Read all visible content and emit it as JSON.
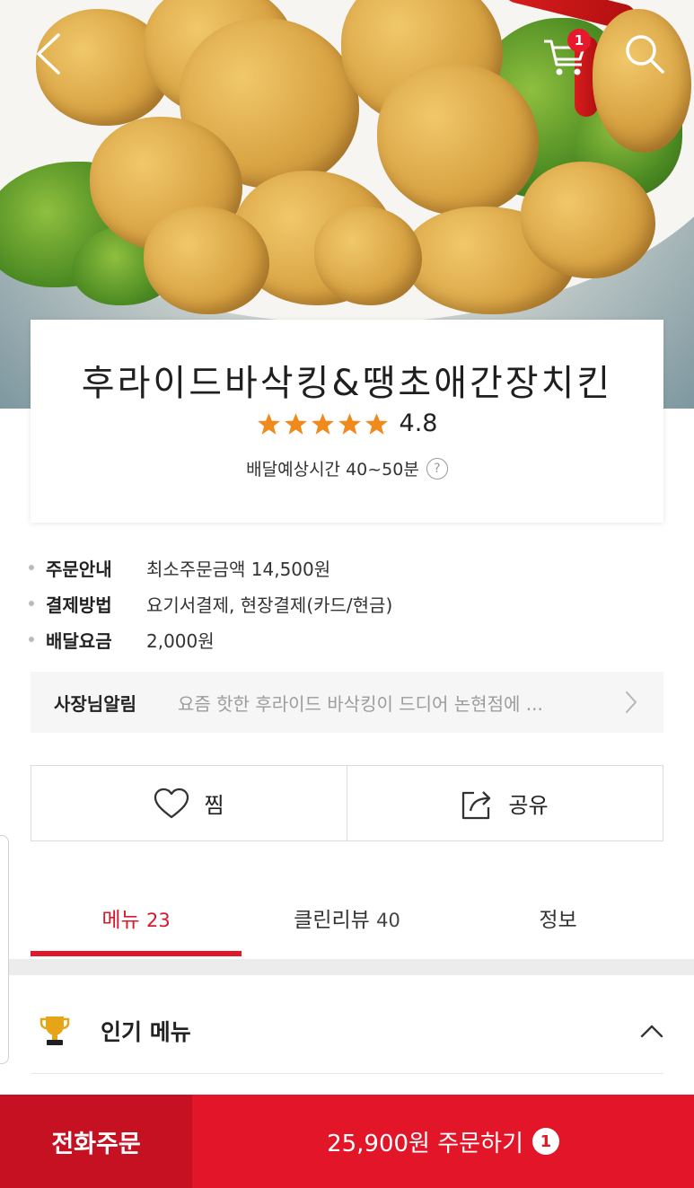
{
  "header": {
    "back_icon": "chevron-left-icon",
    "cart_icon": "cart-icon",
    "cart_badge": "1",
    "search_icon": "search-icon"
  },
  "store": {
    "name": "후라이드바삭킹&땡초애간장치킨",
    "rating": "4.8",
    "rating_value": 4.8,
    "stars_max": 5,
    "eta_label": "배달예상시간 40~50분",
    "help_icon_text": "?"
  },
  "info": [
    {
      "label": "주문안내",
      "value": "최소주문금액 14,500원"
    },
    {
      "label": "결제방법",
      "value": "요기서결제, 현장결제(카드/현금)"
    },
    {
      "label": "배달요금",
      "value": "2,000원"
    }
  ],
  "notice": {
    "title": "사장님알림",
    "text": "요즘 핫한 후라이드 바삭킹이 드디어 논현점에 ..."
  },
  "actions": {
    "like_label": "찜",
    "share_label": "공유"
  },
  "tabs": [
    {
      "label": "메뉴",
      "count": "23",
      "active": true
    },
    {
      "label": "클린리뷰",
      "count": "40",
      "active": false
    },
    {
      "label": "정보",
      "count": "",
      "active": false
    }
  ],
  "section": {
    "title": "인기 메뉴",
    "icon": "trophy-icon"
  },
  "bottom": {
    "phone_order_label": "전화주문",
    "cart_order_label": "25,900원 주문하기",
    "cart_count": "1"
  },
  "colors": {
    "accent": "#e21529",
    "accent_dark": "#c51122",
    "star": "#f08a1c",
    "trophy": "#e6a417"
  }
}
